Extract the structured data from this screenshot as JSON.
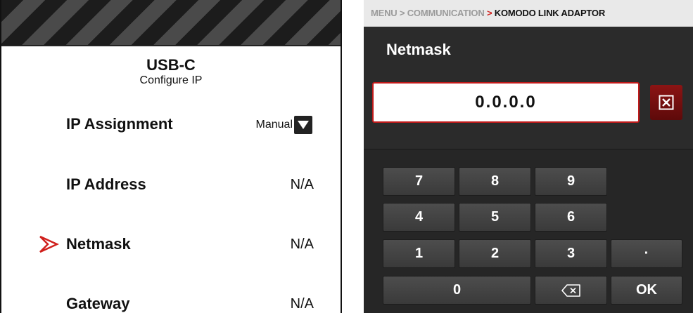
{
  "left_panel": {
    "title": "USB-C",
    "subtitle": "Configure IP",
    "rows": [
      {
        "label": "IP Assignment",
        "value": "Manual"
      },
      {
        "label": "IP Address",
        "value": "N/A"
      },
      {
        "label": "Netmask",
        "value": "N/A"
      },
      {
        "label": "Gateway",
        "value": "N/A"
      }
    ],
    "selected_row": "Netmask",
    "pointer_color": "#d0201c"
  },
  "right_panel": {
    "breadcrumb": {
      "items": [
        "MENU",
        "COMMUNICATION",
        "KOMODO LINK ADAPTOR"
      ],
      "separator": ">"
    },
    "title": "Netmask",
    "field_value": "0.0.0.0",
    "clear_icon": "close-box-icon",
    "keys": {
      "k7": "7",
      "k8": "8",
      "k9": "9",
      "k4": "4",
      "k5": "5",
      "k6": "6",
      "k1": "1",
      "k2": "2",
      "k3": "3",
      "dot": "·",
      "k0": "0",
      "ok": "OK"
    },
    "backspace_icon": "backspace-icon",
    "accent_color": "#c11a1a"
  }
}
